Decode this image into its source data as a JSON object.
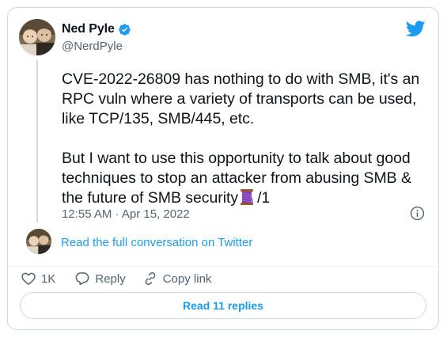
{
  "author": {
    "name": "Ned Pyle",
    "handle": "@NerdPyle",
    "verified": true
  },
  "tweet": {
    "paragraph_1": "CVE-2022-26809 has nothing to do with SMB, it's an RPC vuln where a variety of transports can be used, like TCP/135, SMB/445, etc.",
    "paragraph_2_text": "But I want to use this opportunity to talk about good techniques to stop an attacker from abusing SMB & the future of SMB security",
    "paragraph_2_suffix": "/1",
    "emoji_icon": "thread-spool-emoji",
    "timestamp": "12:55 AM · Apr 15, 2022"
  },
  "conversation_link": "Read the full conversation on Twitter",
  "actions": {
    "like_count": "1K",
    "reply_label": "Reply",
    "copy_label": "Copy link"
  },
  "replies_button": "Read 11 replies",
  "colors": {
    "accent": "#1d9bf0",
    "text": "#0f1419",
    "secondary": "#536471",
    "border": "#cfd9de",
    "verified": "#1d9bf0",
    "like_heart": "#536471"
  },
  "icons": {
    "brand": "twitter-bird-icon",
    "verified": "verified-badge-icon",
    "info": "info-icon",
    "like": "heart-icon",
    "reply": "reply-bubble-icon",
    "copy": "link-icon"
  }
}
